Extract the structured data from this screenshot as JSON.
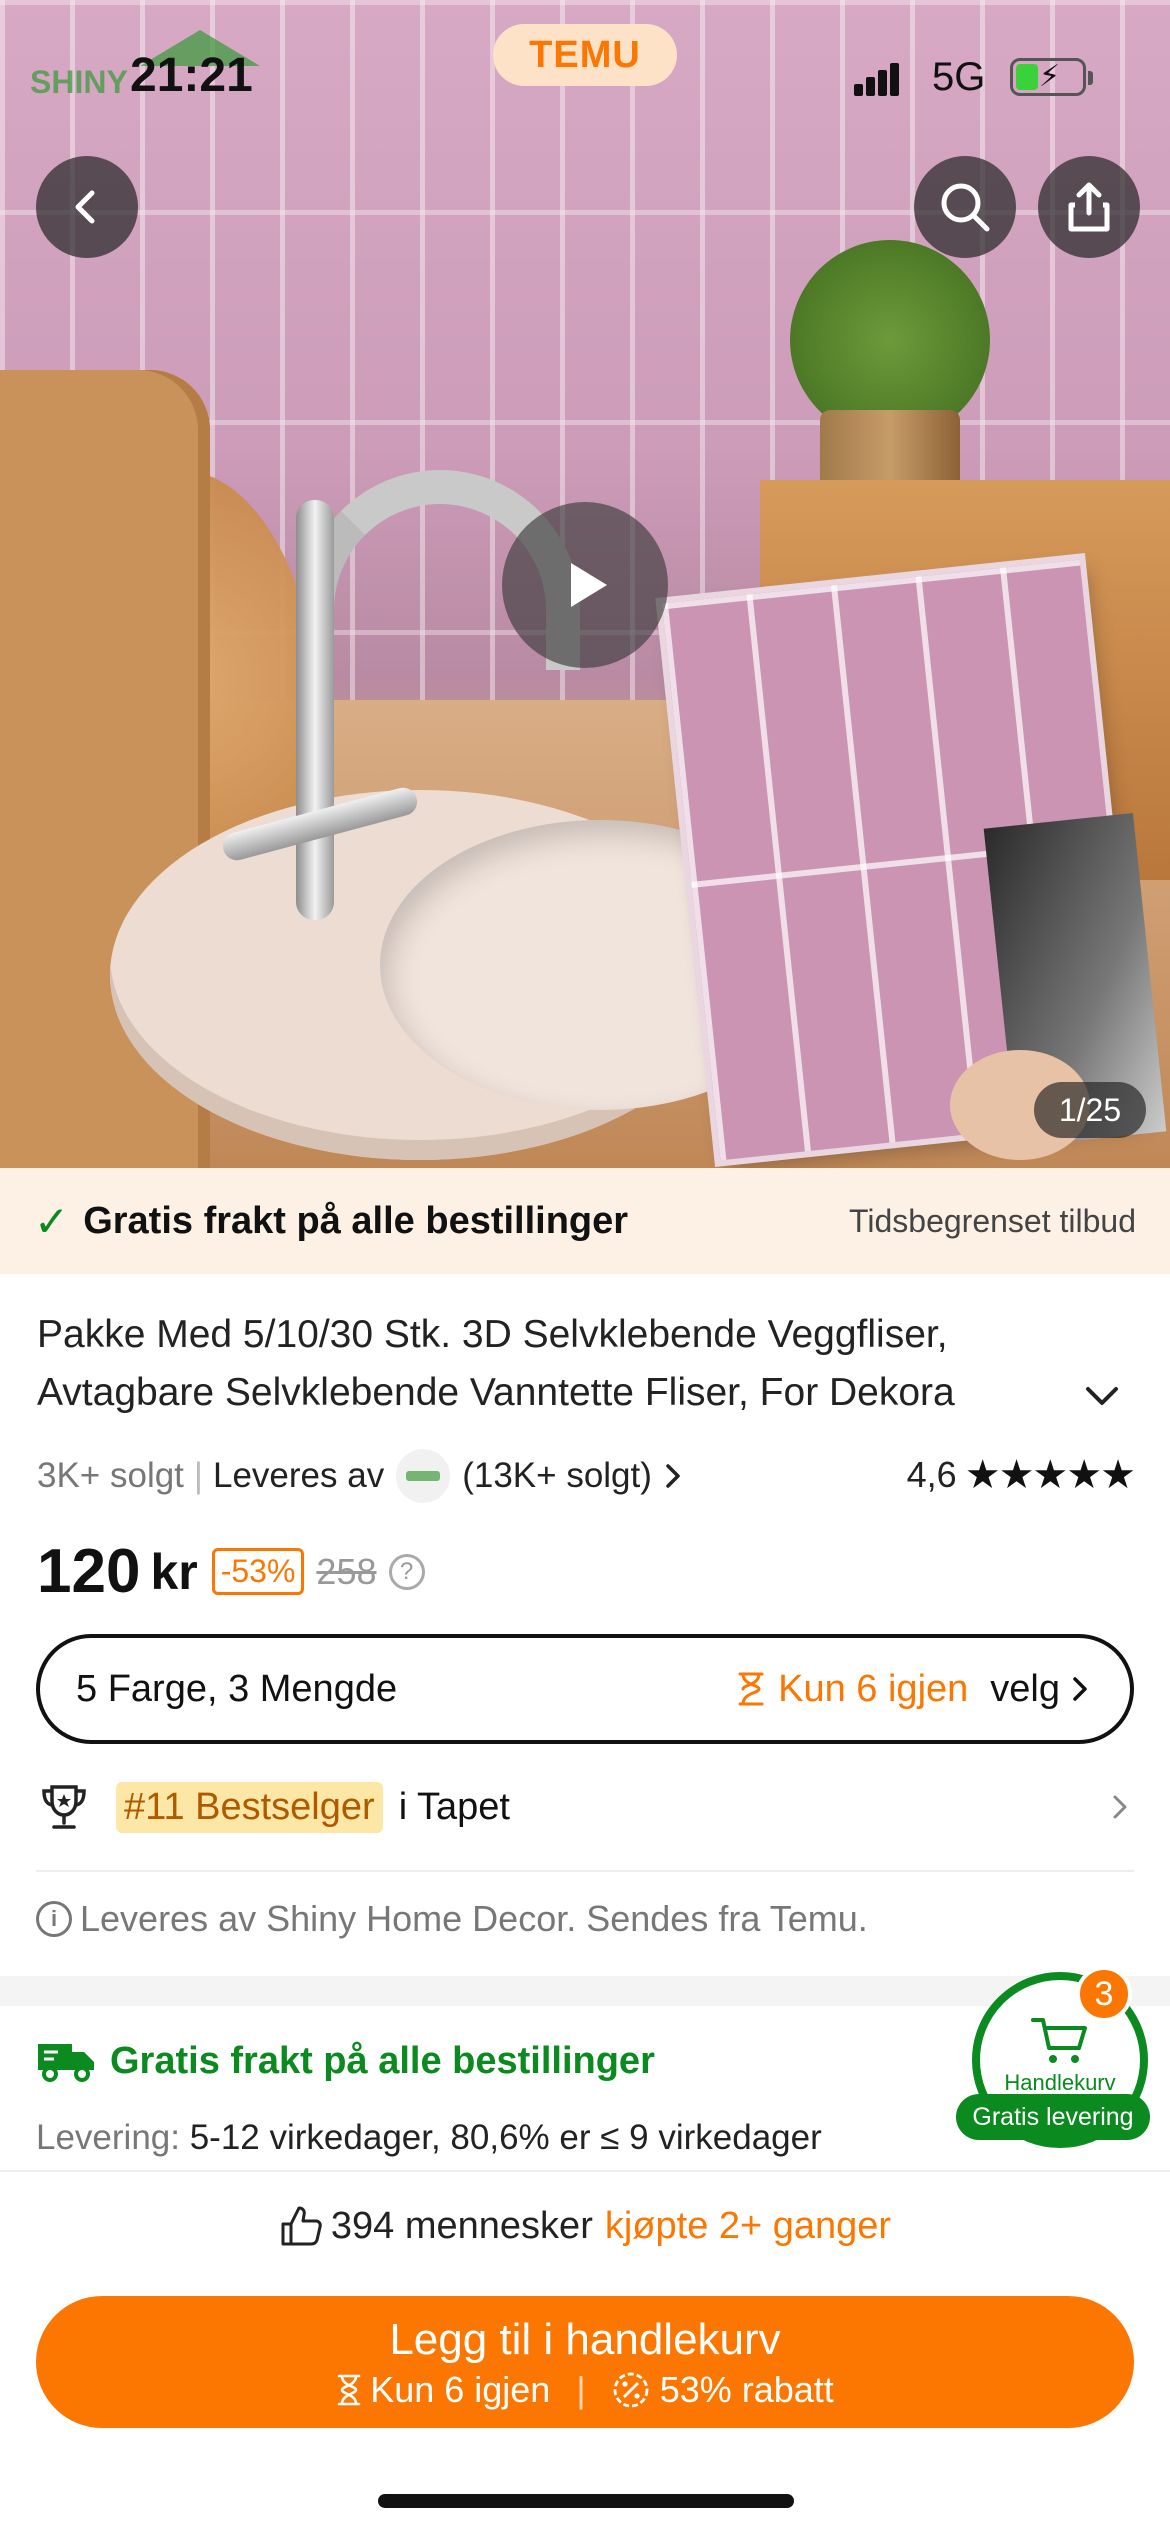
{
  "status_bar": {
    "time": "21:21",
    "network": "5G",
    "brand_pill": "TEMU",
    "overlay_logo_text": "SHINY"
  },
  "gallery": {
    "counter": "1/25"
  },
  "banner": {
    "free_shipping": "Gratis frakt på alle bestillinger",
    "limited_offer": "Tidsbegrenset tilbud"
  },
  "product": {
    "title_line1": "Pakke Med 5/10/30 Stk. 3D Selvklebende Veggfliser,",
    "title_line2": "Avtagbare Selvklebende Vanntette Fliser, For Dekora",
    "sold": "3K+ solgt",
    "separator": "|",
    "delivered_by": "Leveres av",
    "seller_sold": "(13K+ solgt)",
    "rating": "4,6",
    "rating_value": 4.6,
    "stars": "★★★★★"
  },
  "price": {
    "current": "120",
    "unit": "kr",
    "discount": "-53%",
    "original": "258",
    "help": "?"
  },
  "variant": {
    "label": "5 Farge, 3 Mengde",
    "stock": "Kun 6 igjen",
    "choose": "velg"
  },
  "bestseller": {
    "badge": "#11 Bestselger",
    "category": "i Tapet"
  },
  "seller_info": "Leveres av Shiny Home Decor. Sendes fra Temu.",
  "shipping": {
    "title": "Gratis frakt på alle bestillinger",
    "delivery_label": "Levering:",
    "delivery_value": "5-12 virkedager, 80,6% er ≤ 9 virkedager"
  },
  "cart": {
    "count": "3",
    "label": "Handlekurv",
    "badge": "Gratis levering"
  },
  "social_proof": {
    "count": "394 mennesker",
    "highlight": "kjøpte 2+ ganger"
  },
  "cta": {
    "main": "Legg til i handlekurv",
    "stock": "Kun 6 igjen",
    "divider": "|",
    "discount": "53% rabatt"
  },
  "colors": {
    "accent": "#fb7701",
    "green": "#0a8a1f"
  },
  "icons": [
    "back-icon",
    "search-icon",
    "share-icon",
    "play-icon",
    "check-icon",
    "chevron-down-icon",
    "chevron-right-icon",
    "help-icon",
    "hourglass-icon",
    "trophy-icon",
    "info-icon",
    "truck-icon",
    "cart-icon",
    "thumbs-up-icon",
    "discount-icon"
  ]
}
